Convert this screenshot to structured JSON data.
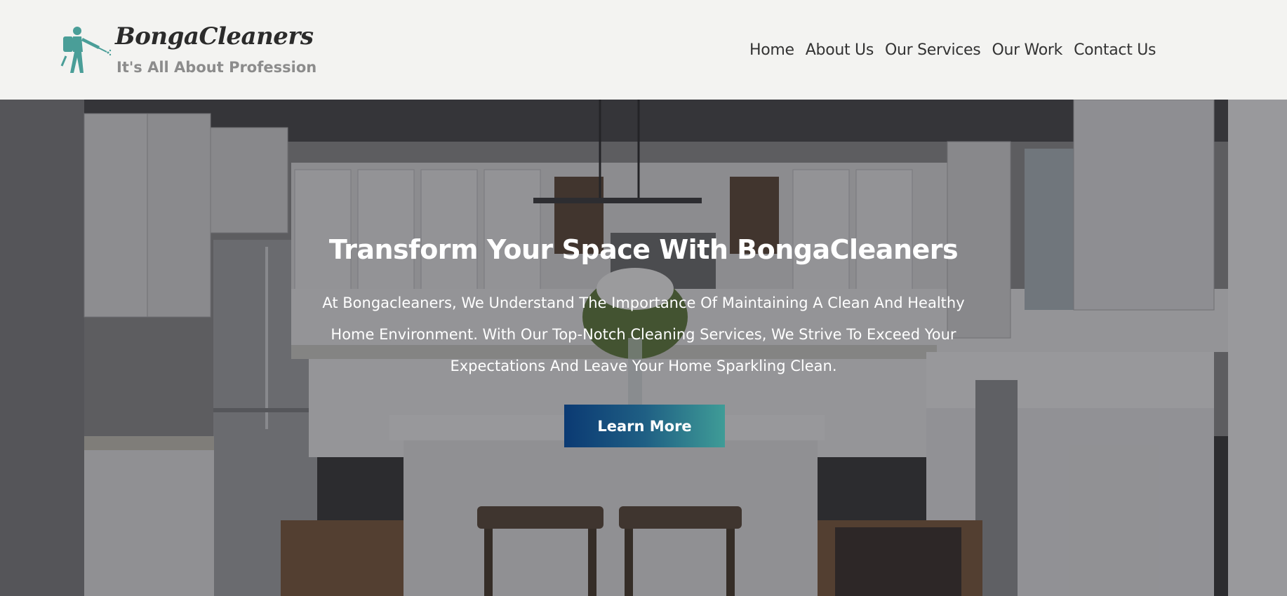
{
  "header": {
    "brand_name": "BongaCleaners",
    "tagline": "It's All About Profession",
    "logo_icon": "cleaner-with-sprayer-icon",
    "brand_color": "#4a9e98"
  },
  "nav": {
    "items": [
      {
        "label": "Home"
      },
      {
        "label": "About Us"
      },
      {
        "label": "Our Services"
      },
      {
        "label": "Our Work"
      },
      {
        "label": "Contact Us"
      }
    ]
  },
  "hero": {
    "background": "kitchen-photo",
    "title": "Transform Your Space With BongaCleaners",
    "text_line1": "At Bongacleaners, We Understand The Importance Of Maintaining A Clean And Healthy",
    "text_line2": "Home Environment. With Our Top-Notch Cleaning Services, We Strive To Exceed Your",
    "text_line3": "Expectations And Leave Your Home Sparkling Clean.",
    "cta_label": "Learn More",
    "cta_gradient": [
      "#0b3a73",
      "#3f9c97"
    ]
  }
}
